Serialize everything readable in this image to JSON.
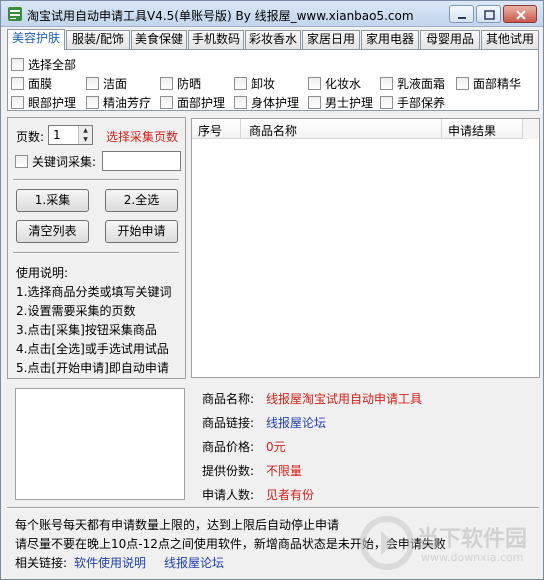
{
  "window": {
    "title": "淘宝试用自动申请工具V4.5(单账号版)  By 线报屋_www.xianbao5.com"
  },
  "tabs": [
    "美容护肤",
    "服装/配饰",
    "美食保健",
    "手机数码",
    "彩妆香水",
    "家居日用",
    "家用电器",
    "母婴用品",
    "其他试用"
  ],
  "categories": {
    "select_all": "选择全部",
    "items": [
      "面膜",
      "洁面",
      "防晒",
      "卸妆",
      "化妆水",
      "乳液面霜",
      "面部精华",
      "眼部护理",
      "精油芳疗",
      "面部护理",
      "身体护理",
      "男士护理",
      "手部保养"
    ]
  },
  "controls": {
    "pages_label": "页数:",
    "pages_value": "1",
    "pages_hint": "选择采集页数",
    "keyword_label": "关键词采集:",
    "keyword_value": "",
    "collect_button": "1.采集",
    "select_all_button": "2.全选",
    "clear_button": "清空列表",
    "start_button": "开始申请"
  },
  "instructions": {
    "title": "使用说明:",
    "steps": [
      "1.选择商品分类或填写关键词",
      "2.设置需要采集的页数",
      "3.点击[采集]按钮采集商品",
      "4.点击[全选]或手选试用试品",
      "5.点击[开始申请]即自动申请"
    ]
  },
  "table": {
    "columns": [
      "序号",
      "商品名称",
      "申请结果"
    ],
    "rows": []
  },
  "details": {
    "name_label": "商品名称:",
    "name_value": "线报屋淘宝试用自动申请工具",
    "link_label": "商品链接:",
    "link_value": "线报屋论坛",
    "price_label": "商品价格:",
    "price_value": "0元",
    "supply_label": "提供份数:",
    "supply_value": "不限量",
    "applicants_label": "申请人数:",
    "applicants_value": "见者有份"
  },
  "footer": {
    "line1": "每个账号每天都有申请数量上限的，达到上限后自动停止申请",
    "line2": "请尽量不要在晚上10点-12点之间使用软件，新增商品状态是未开始，会申请失败",
    "links_label": "相关链接:",
    "link1": "软件使用说明",
    "link2": "线报屋论坛"
  },
  "watermark": {
    "brand": "当下软件园",
    "url": "www.downxia.com"
  },
  "colors": {
    "accent_red": "#d0201a",
    "link_blue": "#1f3fb0",
    "tab_active": "#1f5fb5"
  }
}
